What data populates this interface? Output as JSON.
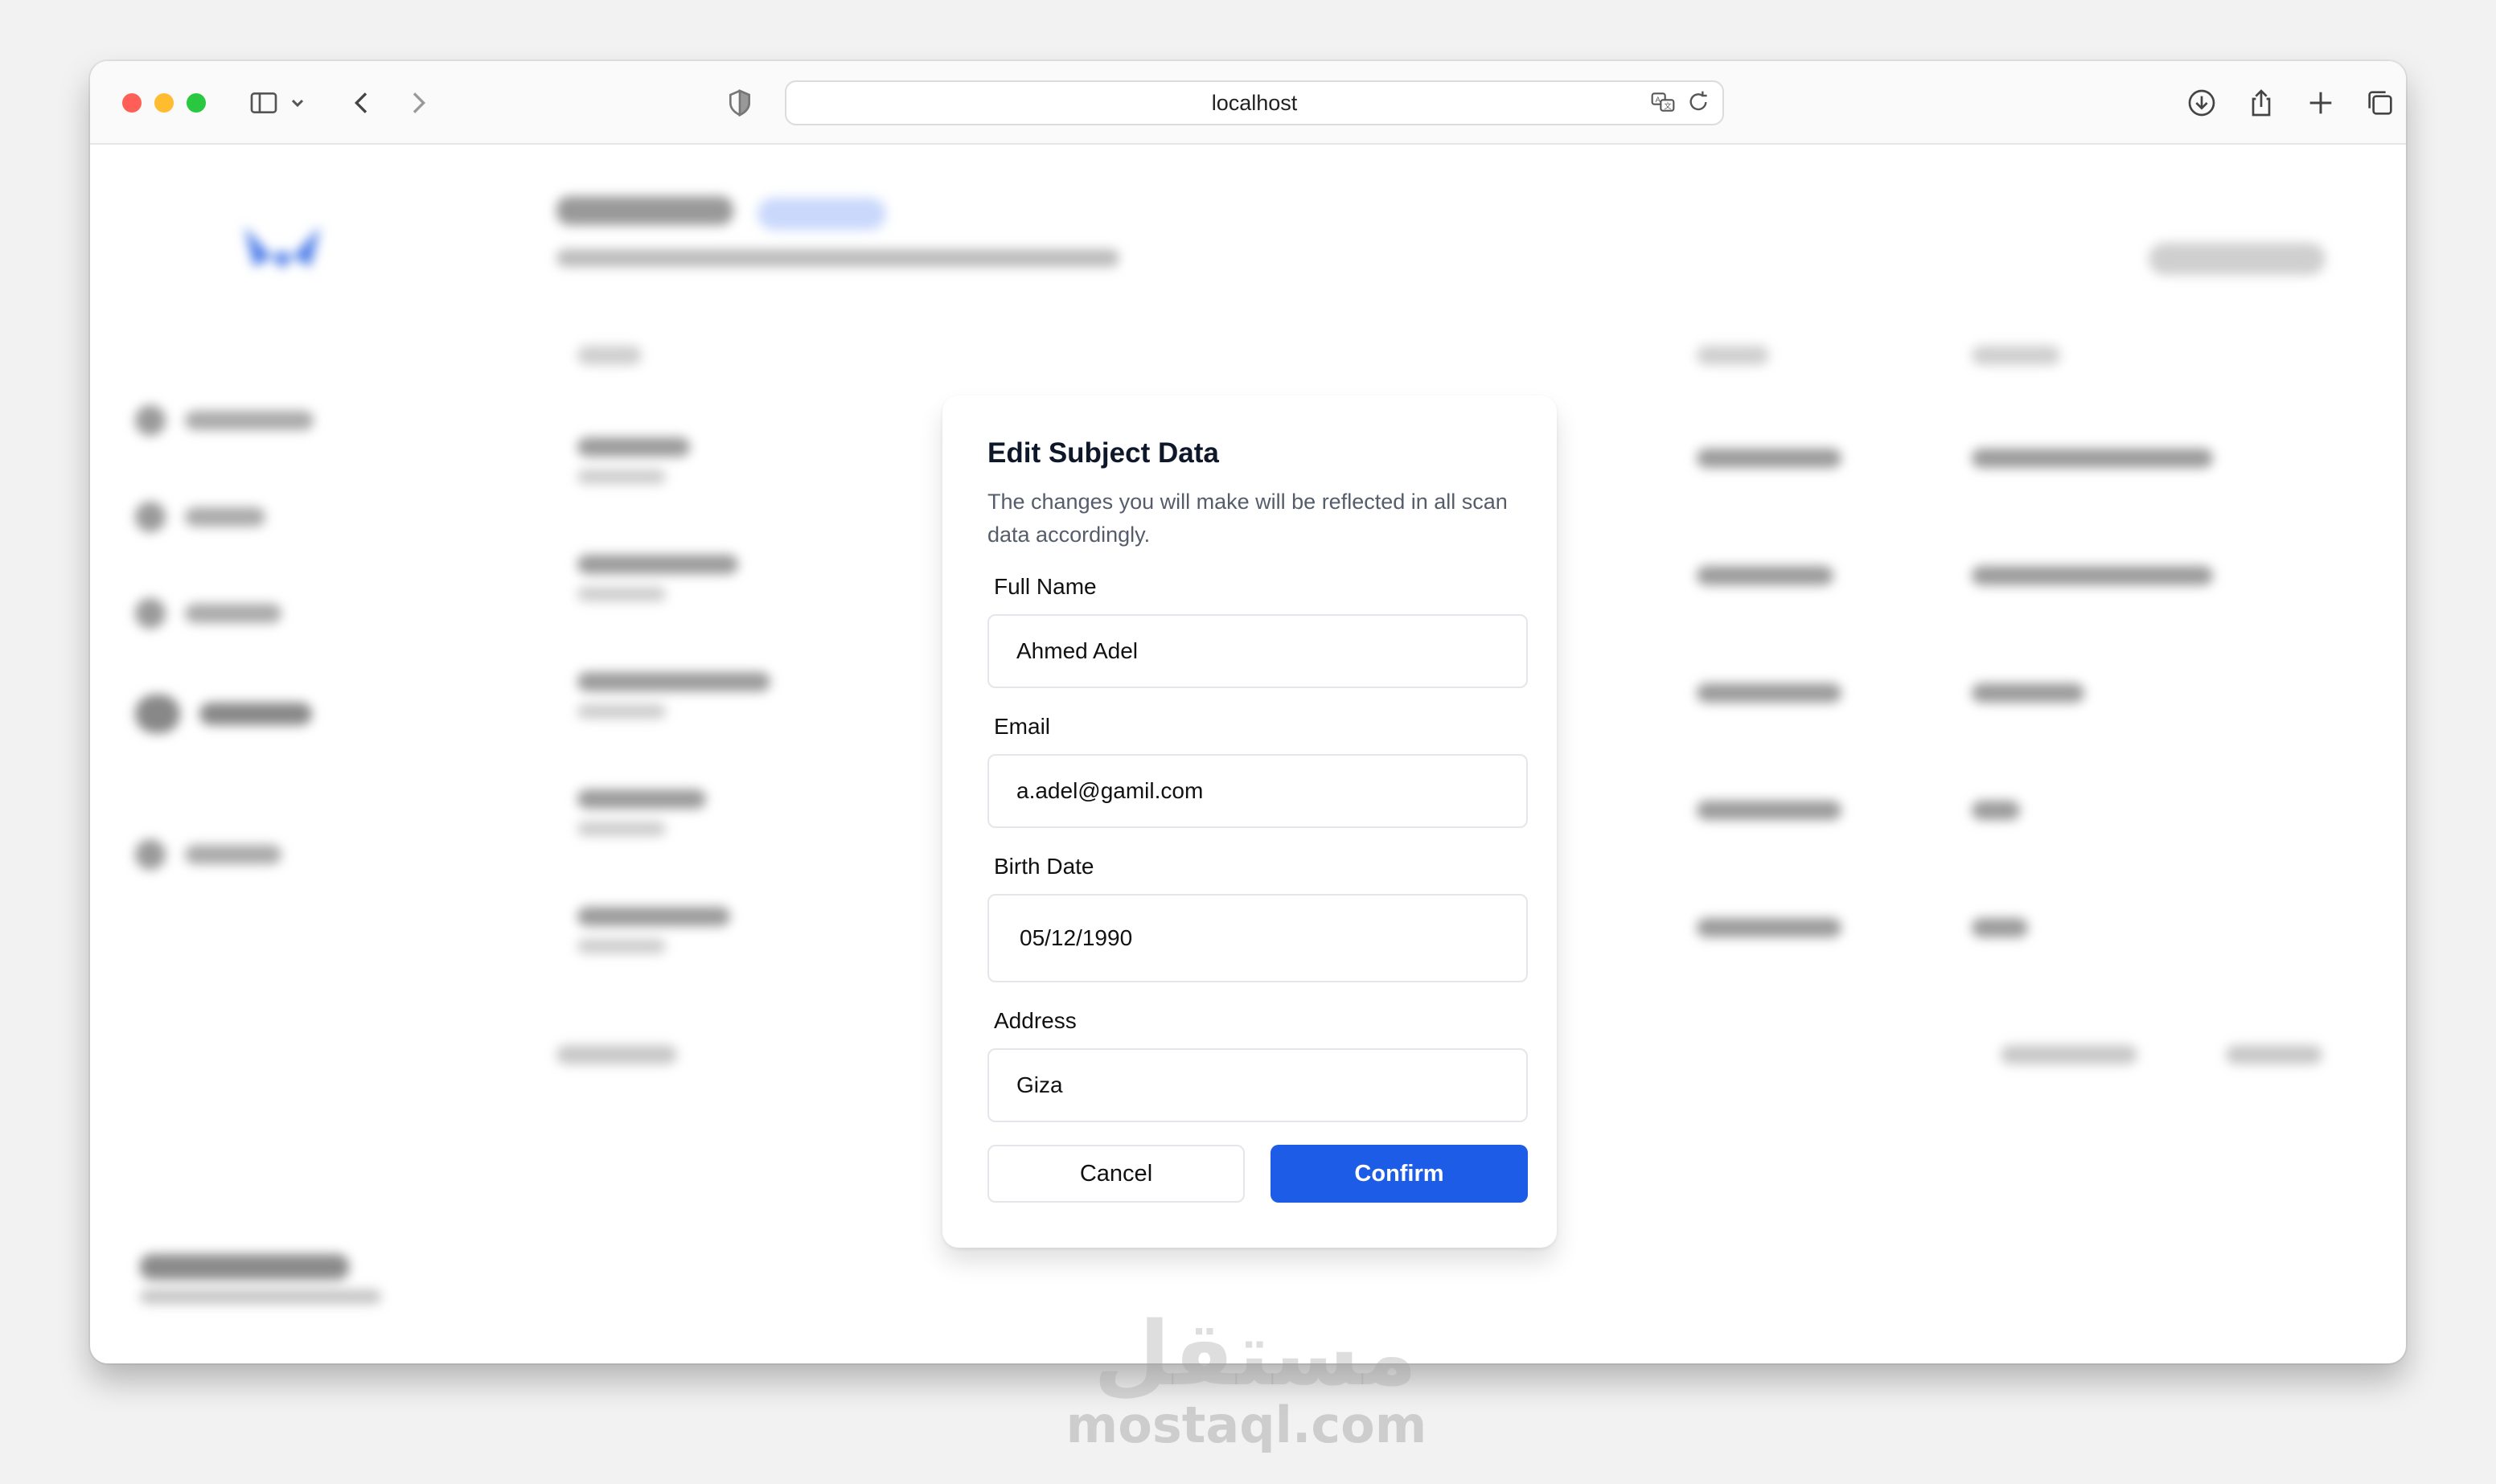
{
  "browser": {
    "url": "localhost",
    "icons": {
      "sidebar": "sidebar-icon",
      "back": "chevron-left-icon",
      "forward": "chevron-right-icon",
      "privacy": "shield-icon",
      "translate": "translate-icon",
      "reload": "reload-icon",
      "downloads": "download-icon",
      "share": "share-icon",
      "new_tab": "plus-icon",
      "tabs": "tabs-overview-icon"
    }
  },
  "modal": {
    "title": "Edit Subject Data",
    "description": "The changes you will make will be reflected in all scan data accordingly.",
    "fields": {
      "full_name": {
        "label": "Full Name",
        "value": "Ahmed Adel"
      },
      "email": {
        "label": "Email",
        "value": "a.adel@gamil.com"
      },
      "birth_date": {
        "label": "Birth Date",
        "value": "05/12/1990"
      },
      "address": {
        "label": "Address",
        "value": "Giza"
      }
    },
    "cancel_label": "Cancel",
    "confirm_label": "Confirm"
  },
  "colors": {
    "accent": "#1d5ce6",
    "traffic_red": "#ff5f57",
    "traffic_yellow": "#febc2e",
    "traffic_green": "#28c840"
  },
  "watermark": {
    "arabic": "مستقل",
    "latin": "mostaql.com"
  }
}
